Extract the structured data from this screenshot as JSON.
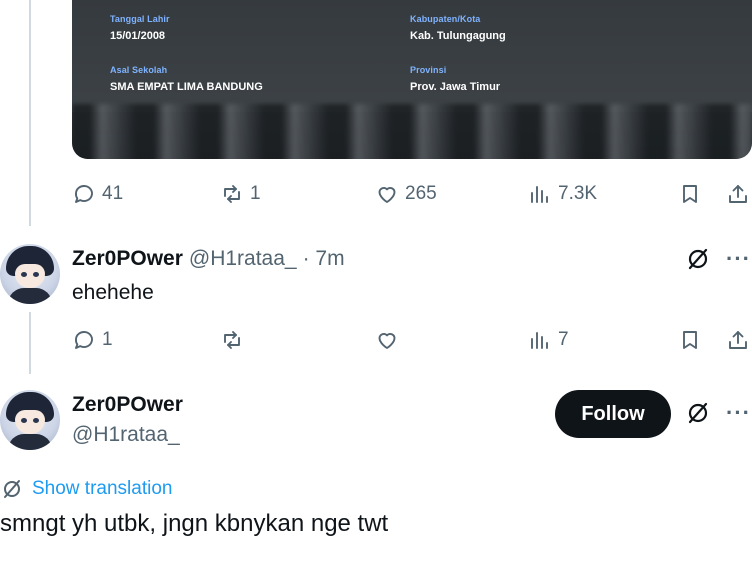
{
  "quoted_card": {
    "fields": [
      {
        "label": "Tanggal Lahir",
        "value": "15/01/2008"
      },
      {
        "label": "Kabupaten/Kota",
        "value": "Kab. Tulungagung"
      },
      {
        "label": "Asal Sekolah",
        "value": "SMA EMPAT LIMA BANDUNG"
      },
      {
        "label": "Provinsi",
        "value": "Prov. Jawa Timur"
      }
    ]
  },
  "top_tweet_actions": {
    "replies": "41",
    "reposts": "1",
    "likes": "265",
    "views": "7.3K"
  },
  "reply": {
    "display_name": "Zer0POwer",
    "handle": "@H1rataa_",
    "time": "· 7m",
    "text": "ehehehe",
    "actions": {
      "replies": "1",
      "reposts": "",
      "likes": "",
      "views": "7"
    }
  },
  "main_tweet": {
    "display_name": "Zer0POwer",
    "handle": "@H1rataa_",
    "follow_label": "Follow",
    "translate_label": "Show translation",
    "text": "smngt yh utbk, jngn kbnykan nge twt"
  },
  "colors": {
    "link": "#1d9bf0",
    "text": "#0f1419",
    "muted": "#536471",
    "follow_bg": "#0f1419"
  }
}
